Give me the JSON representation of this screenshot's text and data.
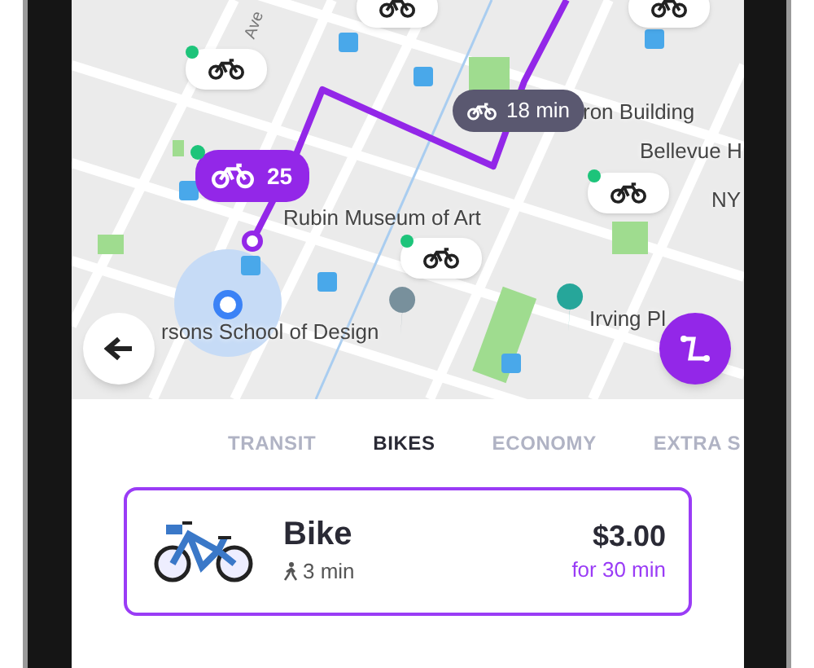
{
  "map": {
    "labels": [
      {
        "kind": "street",
        "text": "Ave"
      },
      {
        "kind": "place",
        "text": "ron Building"
      },
      {
        "kind": "place",
        "text": "Bellevue H"
      },
      {
        "kind": "place",
        "text": "NY"
      },
      {
        "kind": "place",
        "text": "Rubin Museum of Art"
      },
      {
        "kind": "place",
        "text": "rsons School of Design"
      },
      {
        "kind": "place",
        "text": "Irving Pl"
      }
    ],
    "dock_marker": {
      "count": "25"
    },
    "route_badge": {
      "text": "18 min"
    }
  },
  "tabs": [
    {
      "label": "TRANSIT",
      "selected": false
    },
    {
      "label": "BIKES",
      "selected": true
    },
    {
      "label": "ECONOMY",
      "selected": false
    },
    {
      "label": "EXTRA S",
      "selected": false
    }
  ],
  "options": [
    {
      "name": "Bike",
      "walk": "3 min",
      "price": "$3.00",
      "price_note": "for 30 min",
      "selected": true
    }
  ]
}
